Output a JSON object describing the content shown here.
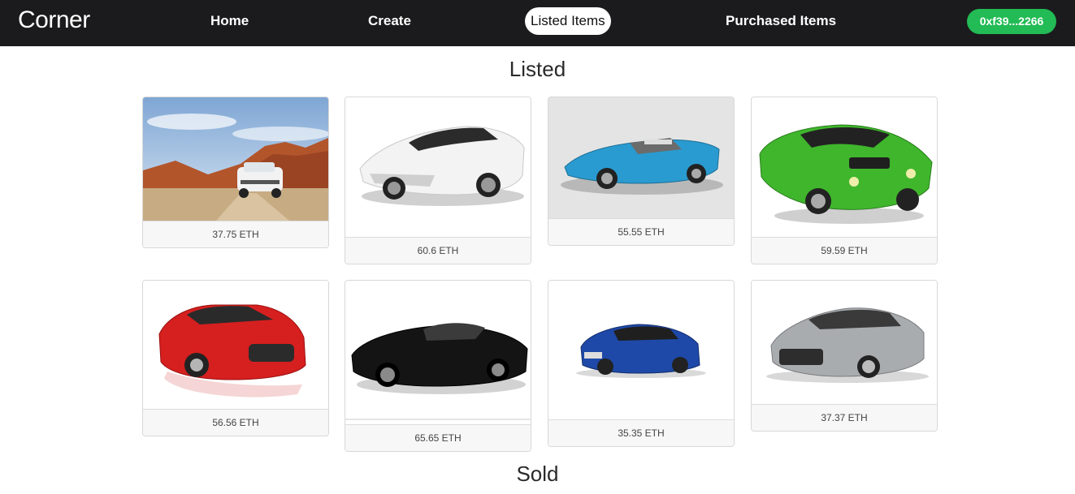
{
  "nav": {
    "brand": "Corner",
    "links": [
      {
        "label": "Home",
        "active": false
      },
      {
        "label": "Create",
        "active": false
      },
      {
        "label": "Listed Items",
        "active": true
      },
      {
        "label": "Purchased Items",
        "active": false
      }
    ],
    "wallet": "0xf39...2266",
    "wallet_color": "#22bb55"
  },
  "sections": {
    "listed": "Listed",
    "sold": "Sold"
  },
  "items": [
    {
      "price": "37.75 ETH",
      "image": "white-suv-desert-photo",
      "car_color": "#f1f1f1"
    },
    {
      "price": "60.6 ETH",
      "image": "white-sports-car-photo",
      "car_color": "#eeeeee"
    },
    {
      "price": "55.55 ETH",
      "image": "blue-convertible-sports-car-photo",
      "car_color": "#2a9bd0"
    },
    {
      "price": "59.59 ETH",
      "image": "green-classic-sports-car-photo",
      "car_color": "#3fb62c"
    },
    {
      "price": "56.56 ETH",
      "image": "red-sedan-photo",
      "car_color": "#d61f1f"
    },
    {
      "price": "65.65 ETH",
      "image": "black-supercar-photo",
      "car_color": "#141414"
    },
    {
      "price": "35.35 ETH",
      "image": "blue-sedan-photo",
      "car_color": "#1e49a8"
    },
    {
      "price": "37.37 ETH",
      "image": "silver-sedan-photo",
      "car_color": "#a9acaf"
    }
  ]
}
